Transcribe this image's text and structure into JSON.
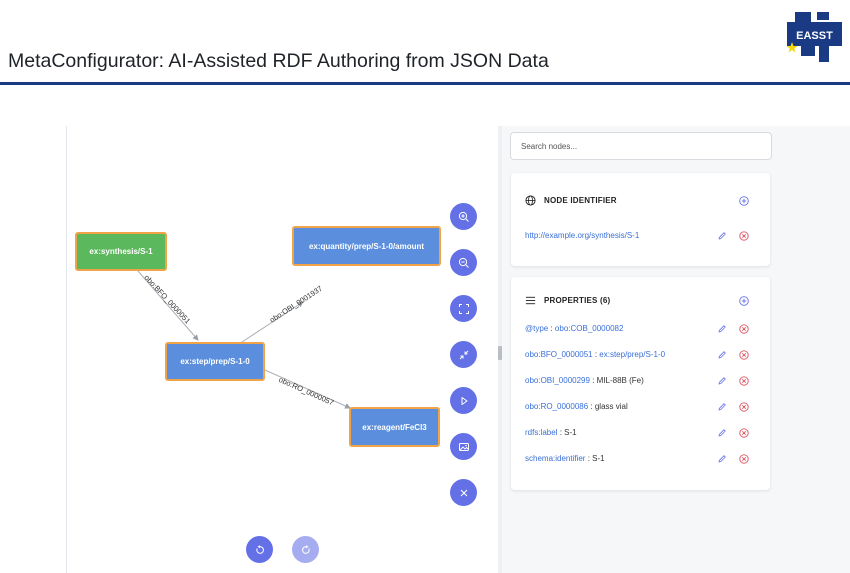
{
  "slide": {
    "title": "MetaConfigurator: AI-Assisted RDF Authoring from JSON Data",
    "logo_text": "EASST"
  },
  "graph": {
    "nodes": [
      {
        "id": "synthesis",
        "label": "ex:synthesis/S-1",
        "color": "green"
      },
      {
        "id": "amount",
        "label": "ex:quantity/prep/S-1-0/amount",
        "color": "blue"
      },
      {
        "id": "step",
        "label": "ex:step/prep/S-1-0",
        "color": "blue"
      },
      {
        "id": "reagent",
        "label": "ex:reagent/FeCl3",
        "color": "blue"
      }
    ],
    "edges": [
      {
        "label": "obo:BFO_0000051"
      },
      {
        "label": "obo:OBI_0001937"
      },
      {
        "label": "obo:RO_0000057"
      }
    ]
  },
  "controls": {
    "zoom_in": "zoom-in-icon",
    "zoom_out": "zoom-out-icon",
    "fit_view": "expand-icon",
    "collapse": "collapse-icon",
    "play": "play-icon",
    "export_image": "image-icon",
    "close": "close-icon",
    "undo": "undo-icon",
    "redo": "redo-icon"
  },
  "panel": {
    "search_placeholder": "Search nodes...",
    "identifier": {
      "header": "NODE IDENTIFIER",
      "value": "http://example.org/synthesis/S-1"
    },
    "properties": {
      "header": "PROPERTIES (6)",
      "items": [
        {
          "key": "@type",
          "sep": " : ",
          "value": "obo:COB_0000082",
          "value_is_link": true
        },
        {
          "key": "obo:BFO_0000051",
          "sep": " : ",
          "value": "ex:step/prep/S-1-0",
          "value_is_link": true
        },
        {
          "key": "obo:OBI_0000299",
          "sep": " : ",
          "value": "MIL-88B (Fe)",
          "value_is_link": false
        },
        {
          "key": "obo:RO_0000086",
          "sep": " : ",
          "value": "glass vial",
          "value_is_link": false
        },
        {
          "key": "rdfs:label",
          "sep": " : ",
          "value": "S-1",
          "value_is_link": false
        },
        {
          "key": "schema:identifier",
          "sep": " : ",
          "value": "S-1",
          "value_is_link": false
        }
      ]
    }
  },
  "colors": {
    "accent": "#6470e6",
    "link": "#3a6fd8",
    "delete": "#e05260",
    "node_green": "#5cb85c",
    "node_blue": "#5b8fdd",
    "node_border": "#f0a347",
    "title_rule": "#1b3a84"
  }
}
